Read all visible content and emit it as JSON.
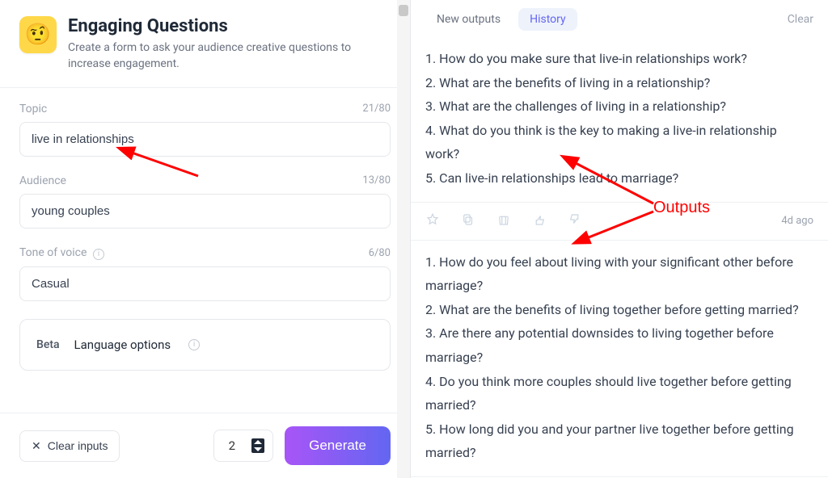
{
  "header": {
    "title": "Engaging Questions",
    "description": "Create a form to ask your audience creative questions to increase engagement.",
    "emoji": "🤨"
  },
  "form": {
    "topic": {
      "label": "Topic",
      "value": "live in relationships",
      "count": "21/80"
    },
    "audience": {
      "label": "Audience",
      "value": "young couples",
      "count": "13/80"
    },
    "tone": {
      "label": "Tone of voice",
      "value": "Casual",
      "count": "6/80"
    },
    "language": {
      "beta": "Beta",
      "label": "Language options"
    }
  },
  "bottom": {
    "clear": "Clear inputs",
    "qty": "2",
    "generate": "Generate"
  },
  "tabs": {
    "new": "New outputs",
    "history": "History",
    "clear": "Clear"
  },
  "outputs": {
    "timestamp": "4d ago",
    "block1": [
      "1. How do you make sure that live-in relationships work?",
      "2. What are the benefits of living in a relationship?",
      "3. What are the challenges of living in a relationship?",
      "4. What do you think is the key to making a live-in relationship work?",
      "5. Can live-in relationships lead to marriage?"
    ],
    "block2": [
      "1. How do you feel about living with your significant other before marriage?",
      "2. What are the benefits of living together before getting married?",
      "3. Are there any potential downsides to living together before marriage?",
      "4. Do you think more couples should live together before getting married?",
      "5. How long did you and your partner live together before getting married?"
    ]
  },
  "annotation": {
    "label": "Outputs"
  }
}
